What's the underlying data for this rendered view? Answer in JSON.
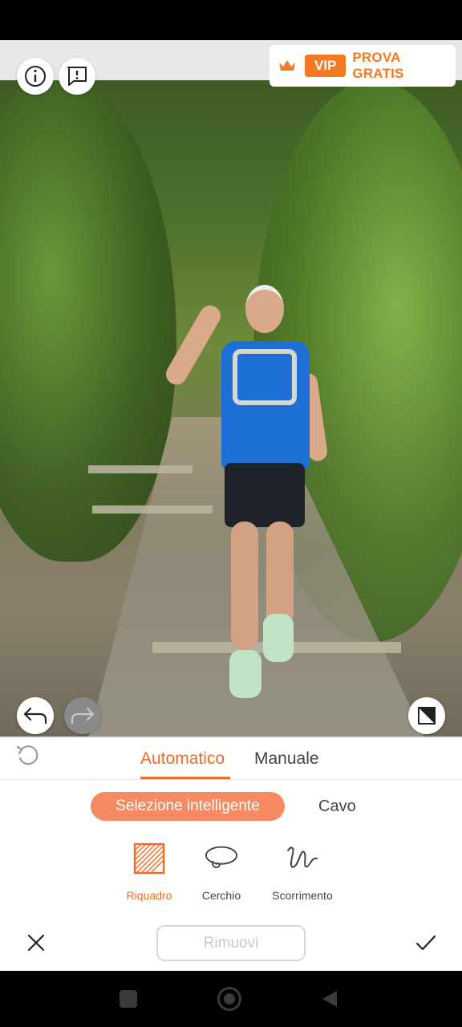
{
  "top_bar": {
    "vip_badge": "VIP",
    "vip_cta": "PROVA GRATIS",
    "crown_icon": "crown-icon",
    "info_icon": "info-icon",
    "feedback_icon": "feedback-icon"
  },
  "canvas_toolbar": {
    "undo_icon": "undo-arrow-icon",
    "redo_icon": "redo-arrow-icon",
    "compare_icon": "compare-icon"
  },
  "mode_tabs": [
    {
      "label": "Automatico",
      "active": true
    },
    {
      "label": "Manuale",
      "active": false
    }
  ],
  "selection_modes": {
    "active": "Selezione intelligente",
    "other": "Cavo"
  },
  "tools": [
    {
      "label": "Riquadro",
      "icon": "hatched-square-icon",
      "active": true
    },
    {
      "label": "Cerchio",
      "icon": "lasso-icon",
      "active": false
    },
    {
      "label": "Scorrimento",
      "icon": "scribble-icon",
      "active": false
    }
  ],
  "actions": {
    "remove_label": "Rimuovi",
    "cancel_icon": "close-icon",
    "confirm_icon": "check-icon",
    "reset_icon": "reset-icon"
  },
  "colors": {
    "accent": "#f46a25",
    "pill": "#f58a63"
  }
}
